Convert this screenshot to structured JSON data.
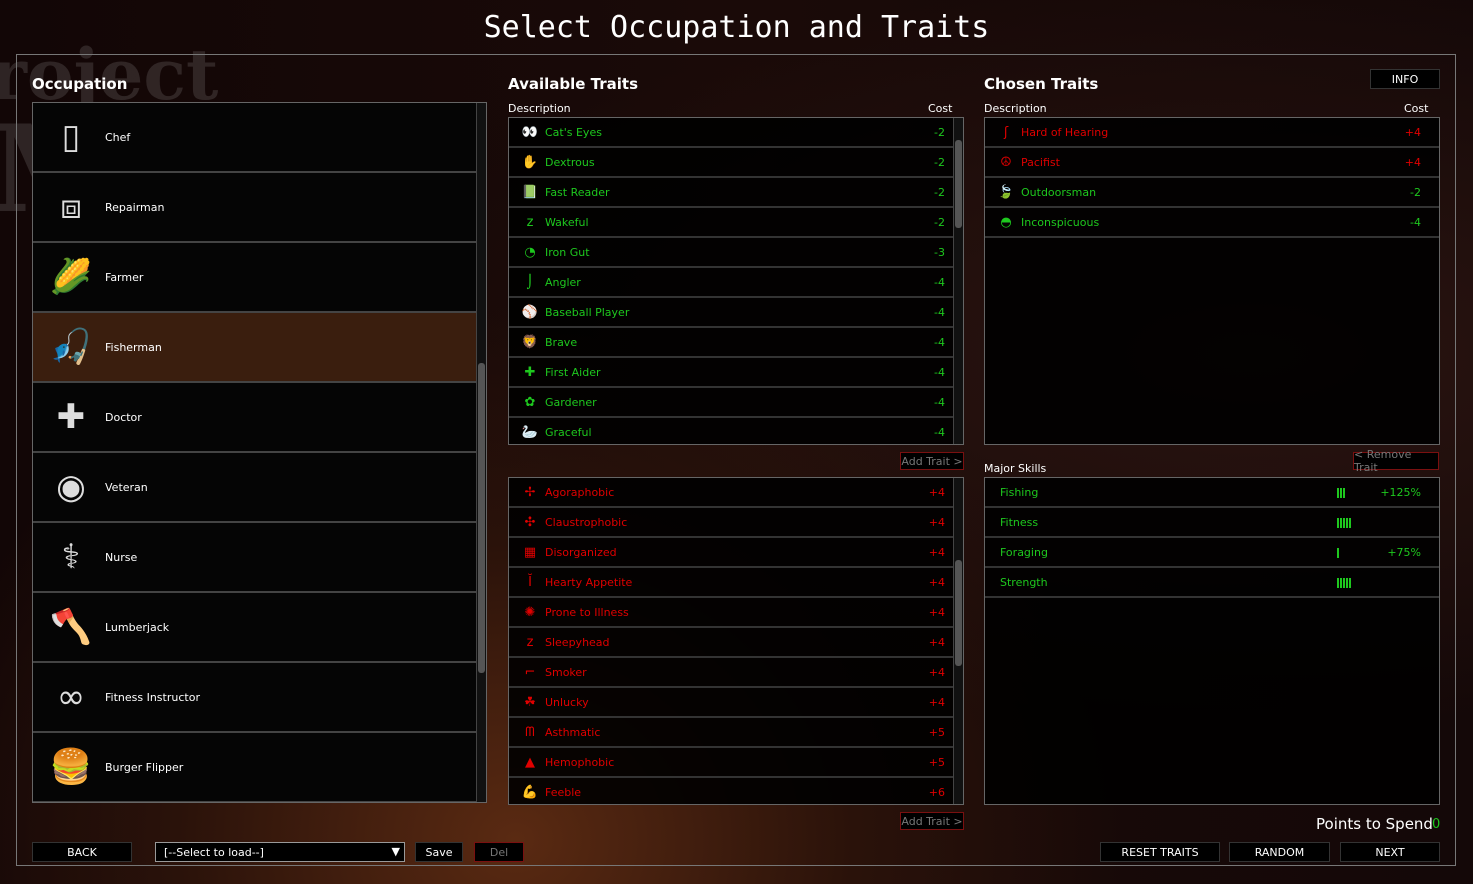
{
  "title": "Select Occupation and Traits",
  "logo_text": "Project Zomboid",
  "occupation": {
    "heading": "Occupation",
    "items": [
      {
        "label": "Chef",
        "icon": "chef-hat-icon",
        "glyph": "▯"
      },
      {
        "label": "Repairman",
        "icon": "toolbox-icon",
        "glyph": "⧈"
      },
      {
        "label": "Farmer",
        "icon": "corn-icon",
        "glyph": "🌽"
      },
      {
        "label": "Fisherman",
        "icon": "fishing-lure-icon",
        "glyph": "🎣",
        "selected": true
      },
      {
        "label": "Doctor",
        "icon": "medical-cross-icon",
        "glyph": "✚"
      },
      {
        "label": "Veteran",
        "icon": "army-seal-icon",
        "glyph": "◉"
      },
      {
        "label": "Nurse",
        "icon": "nurse-caduceus-icon",
        "glyph": "⚕"
      },
      {
        "label": "Lumberjack",
        "icon": "axe-icon",
        "glyph": "🪓"
      },
      {
        "label": "Fitness Instructor",
        "icon": "dumbbell-icon",
        "glyph": "∞"
      },
      {
        "label": "Burger Flipper",
        "icon": "burger-icon",
        "glyph": "🍔"
      }
    ]
  },
  "available": {
    "heading": "Available Traits",
    "col_desc": "Description",
    "col_cost": "Cost",
    "add_label": "Add Trait >",
    "positive": [
      {
        "label": "Cat's Eyes",
        "cost": "-2",
        "icon": "eyes-icon",
        "glyph": "👀"
      },
      {
        "label": "Dextrous",
        "cost": "-2",
        "icon": "hand-icon",
        "glyph": "✋"
      },
      {
        "label": "Fast Reader",
        "cost": "-2",
        "icon": "book-icon",
        "glyph": "📗"
      },
      {
        "label": "Wakeful",
        "cost": "-2",
        "icon": "wakeful-icon",
        "glyph": "z"
      },
      {
        "label": "Iron Gut",
        "cost": "-3",
        "icon": "stomach-icon",
        "glyph": "◔"
      },
      {
        "label": "Angler",
        "cost": "-4",
        "icon": "fishing-hook-icon",
        "glyph": "⌡"
      },
      {
        "label": "Baseball Player",
        "cost": "-4",
        "icon": "baseball-icon",
        "glyph": "⚾"
      },
      {
        "label": "Brave",
        "cost": "-4",
        "icon": "lion-icon",
        "glyph": "🦁"
      },
      {
        "label": "First Aider",
        "cost": "-4",
        "icon": "first-aid-icon",
        "glyph": "✚"
      },
      {
        "label": "Gardener",
        "cost": "-4",
        "icon": "flower-icon",
        "glyph": "✿"
      },
      {
        "label": "Graceful",
        "cost": "-4",
        "icon": "swan-icon",
        "glyph": "🦢"
      }
    ],
    "negative": [
      {
        "label": "Agoraphobic",
        "cost": "+4",
        "icon": "agoraphobic-icon",
        "glyph": "✢"
      },
      {
        "label": "Claustrophobic",
        "cost": "+4",
        "icon": "claustrophobic-icon",
        "glyph": "✣"
      },
      {
        "label": "Disorganized",
        "cost": "+4",
        "icon": "mess-icon",
        "glyph": "▦"
      },
      {
        "label": "Hearty Appetite",
        "cost": "+4",
        "icon": "apple-core-icon",
        "glyph": "Ĭ"
      },
      {
        "label": "Prone to Illness",
        "cost": "+4",
        "icon": "virus-icon",
        "glyph": "✺"
      },
      {
        "label": "Sleepyhead",
        "cost": "+4",
        "icon": "sleep-icon",
        "glyph": "z"
      },
      {
        "label": "Smoker",
        "cost": "+4",
        "icon": "cigarette-icon",
        "glyph": "⌐"
      },
      {
        "label": "Unlucky",
        "cost": "+4",
        "icon": "clover-icon",
        "glyph": "☘"
      },
      {
        "label": "Asthmatic",
        "cost": "+5",
        "icon": "lungs-icon",
        "glyph": "ᗰ"
      },
      {
        "label": "Hemophobic",
        "cost": "+5",
        "icon": "blood-drop-icon",
        "glyph": "▲"
      },
      {
        "label": "Feeble",
        "cost": "+6",
        "icon": "arm-icon",
        "glyph": "💪"
      }
    ]
  },
  "chosen": {
    "heading": "Chosen Traits",
    "info_label": "INFO",
    "col_desc": "Description",
    "col_cost": "Cost",
    "remove_label": "< Remove Trait",
    "items": [
      {
        "label": "Hard of Hearing",
        "cost": "+4",
        "icon": "ear-icon",
        "glyph": "ʃ",
        "tone": "r"
      },
      {
        "label": "Pacifist",
        "cost": "+4",
        "icon": "peace-icon",
        "glyph": "☮",
        "tone": "r"
      },
      {
        "label": "Outdoorsman",
        "cost": "-2",
        "icon": "leaf-icon",
        "glyph": "🍃",
        "tone": "g"
      },
      {
        "label": "Inconspicuous",
        "cost": "-4",
        "icon": "cap-icon",
        "glyph": "◓",
        "tone": "g"
      }
    ]
  },
  "skills": {
    "heading": "Major Skills",
    "items": [
      {
        "label": "Fishing",
        "level": 3,
        "bonus": "+125%"
      },
      {
        "label": "Fitness",
        "level": 5,
        "bonus": ""
      },
      {
        "label": "Foraging",
        "level": 1,
        "bonus": "+75%"
      },
      {
        "label": "Strength",
        "level": 5,
        "bonus": ""
      }
    ]
  },
  "points": {
    "label": "Points to Spend",
    "value": "0"
  },
  "footer": {
    "back": "BACK",
    "select_placeholder": "[--Select to load--]",
    "save": "Save",
    "del": "Del",
    "reset": "RESET TRAITS",
    "random": "RANDOM",
    "next": "NEXT"
  },
  "colors": {
    "positive": "#1ec81e",
    "negative": "#e00000",
    "selected_row": "#3a1e0e"
  }
}
